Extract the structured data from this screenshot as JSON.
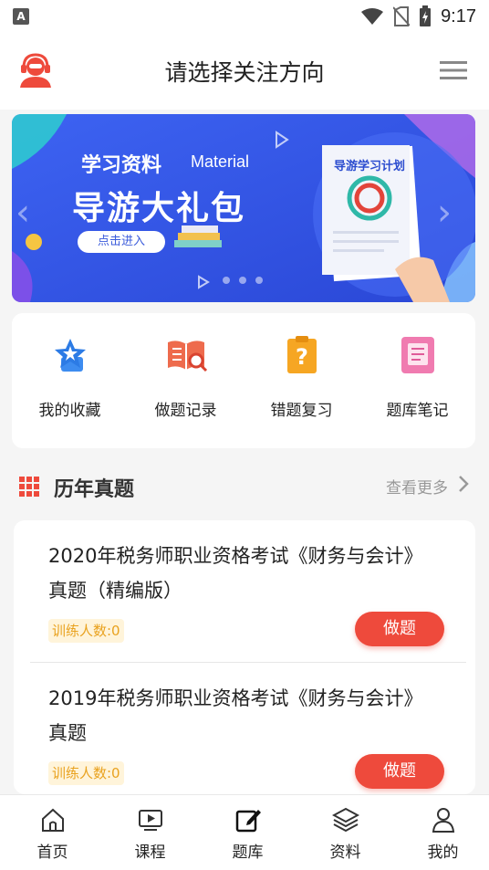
{
  "status_bar": {
    "app_indicator": "A",
    "time": "9:17"
  },
  "header": {
    "title": "请选择关注方向"
  },
  "banner": {
    "subtitle": "学习资料",
    "subtitle_en": "Material",
    "headline": "导游大礼包",
    "button_label": "点击进入",
    "doc_title": "导游学习计划",
    "active_dot": 1,
    "dot_count": 3
  },
  "quick_actions": [
    {
      "label": "我的收藏",
      "icon": "star-badge-icon"
    },
    {
      "label": "做题记录",
      "icon": "book-search-icon"
    },
    {
      "label": "错题复习",
      "icon": "question-clipboard-icon"
    },
    {
      "label": "题库笔记",
      "icon": "notebook-icon"
    }
  ],
  "section": {
    "title": "历年真题",
    "more_label": "查看更多"
  },
  "exams": [
    {
      "title": "2020年税务师职业资格考试《财务与会计》真题（精编版）",
      "count_label": "训练人数:0",
      "button_label": "做题"
    },
    {
      "title": "2019年税务师职业资格考试《财务与会计》真题",
      "count_label": "训练人数:0",
      "button_label": "做题"
    }
  ],
  "tabbar": [
    {
      "label": "首页",
      "icon": "home-icon"
    },
    {
      "label": "课程",
      "icon": "video-play-icon"
    },
    {
      "label": "题库",
      "icon": "edit-icon"
    },
    {
      "label": "资料",
      "icon": "layers-icon"
    },
    {
      "label": "我的",
      "icon": "user-icon"
    }
  ],
  "colors": {
    "accent_red": "#ee4a3c",
    "banner_blue": "#2c4fe0",
    "badge_text": "#e9a21f",
    "badge_bg": "#fff4da"
  }
}
